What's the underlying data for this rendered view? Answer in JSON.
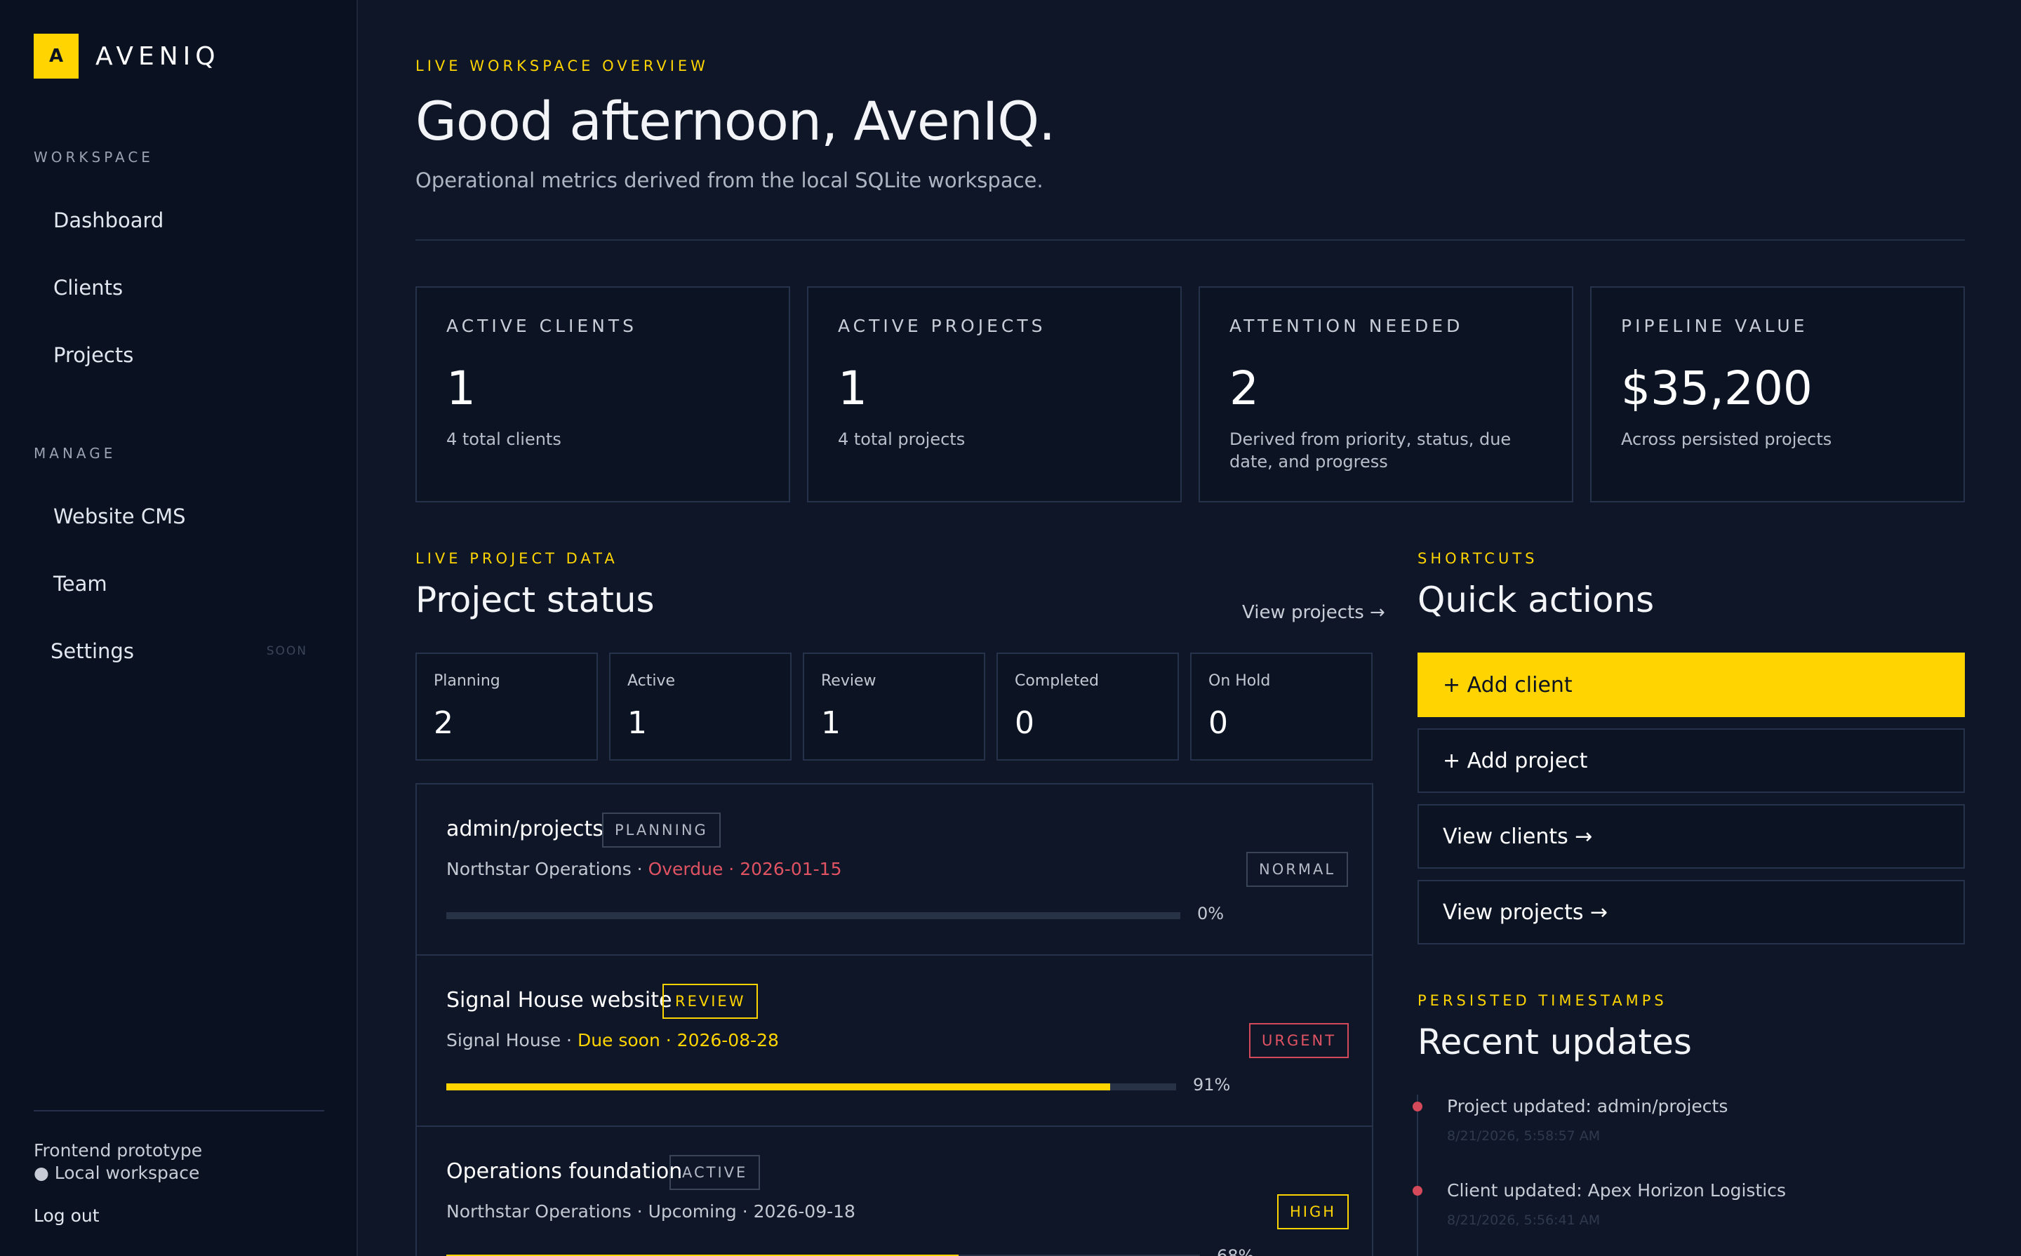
{
  "brand": {
    "mark": "A",
    "name": "AVENIQ"
  },
  "sidebar": {
    "workspace_heading": "WORKSPACE",
    "workspace_items": [
      {
        "label": "Dashboard"
      },
      {
        "label": "Clients"
      },
      {
        "label": "Projects"
      }
    ],
    "manage_heading": "MANAGE",
    "manage_items": [
      {
        "label": "Website CMS"
      },
      {
        "label": "Team"
      },
      {
        "label": "Settings",
        "tag": "SOON"
      }
    ],
    "footer_line1": "Frontend prototype",
    "footer_line2": "● Local workspace",
    "logout": "Log out"
  },
  "header": {
    "eyebrow": "LIVE WORKSPACE OVERVIEW",
    "title": "Good afternoon, AvenIQ.",
    "subtitle": "Operational metrics derived from the local SQLite workspace."
  },
  "stats": [
    {
      "label": "ACTIVE CLIENTS",
      "value": "1",
      "note": "4 total clients"
    },
    {
      "label": "ACTIVE PROJECTS",
      "value": "1",
      "note": "4 total projects"
    },
    {
      "label": "ATTENTION NEEDED",
      "value": "2",
      "note": "Derived from priority, status, due date, and progress"
    },
    {
      "label": "PIPELINE VALUE",
      "value": "$35,200",
      "note": "Across persisted projects"
    }
  ],
  "project_status": {
    "eyebrow": "LIVE PROJECT DATA",
    "title": "Project status",
    "link": "View projects →",
    "counts": [
      {
        "label": "Planning",
        "value": "2"
      },
      {
        "label": "Active",
        "value": "1"
      },
      {
        "label": "Review",
        "value": "1"
      },
      {
        "label": "Completed",
        "value": "0"
      },
      {
        "label": "On Hold",
        "value": "0"
      }
    ],
    "projects": [
      {
        "name": "admin/projects",
        "status": "PLANNING",
        "client": "Northstar Operations · ",
        "due": "Overdue · 2026-01-15",
        "priority": "NORMAL",
        "progress": 0,
        "progress_label": "0%"
      },
      {
        "name": "Signal House website",
        "status": "REVIEW",
        "client": "Signal House · ",
        "due": "Due soon · 2026-08-28",
        "priority": "URGENT",
        "progress": 91,
        "progress_label": "91%"
      },
      {
        "name": "Operations foundation",
        "status": "ACTIVE",
        "client": "Northstar Operations · ",
        "due": "Upcoming · 2026-09-18",
        "priority": "HIGH",
        "progress": 68,
        "progress_label": "68%"
      }
    ]
  },
  "shortcuts": {
    "eyebrow": "SHORTCUTS",
    "title": "Quick actions",
    "buttons": [
      {
        "label": "+ Add client"
      },
      {
        "label": "+ Add project"
      },
      {
        "label": "View clients →"
      },
      {
        "label": "View projects →"
      }
    ]
  },
  "updates": {
    "eyebrow": "PERSISTED TIMESTAMPS",
    "title": "Recent updates",
    "items": [
      {
        "text": "Project updated: admin/projects",
        "time": "8/21/2026, 5:58:57 AM"
      },
      {
        "text": "Client updated: Apex Horizon Logistics",
        "time": "8/21/2026, 5:56:41 AM"
      }
    ]
  },
  "colors": {
    "accent": "#ffd400",
    "danger": "#e05363",
    "background": "#0e1627",
    "sidebar": "#0a1222"
  }
}
